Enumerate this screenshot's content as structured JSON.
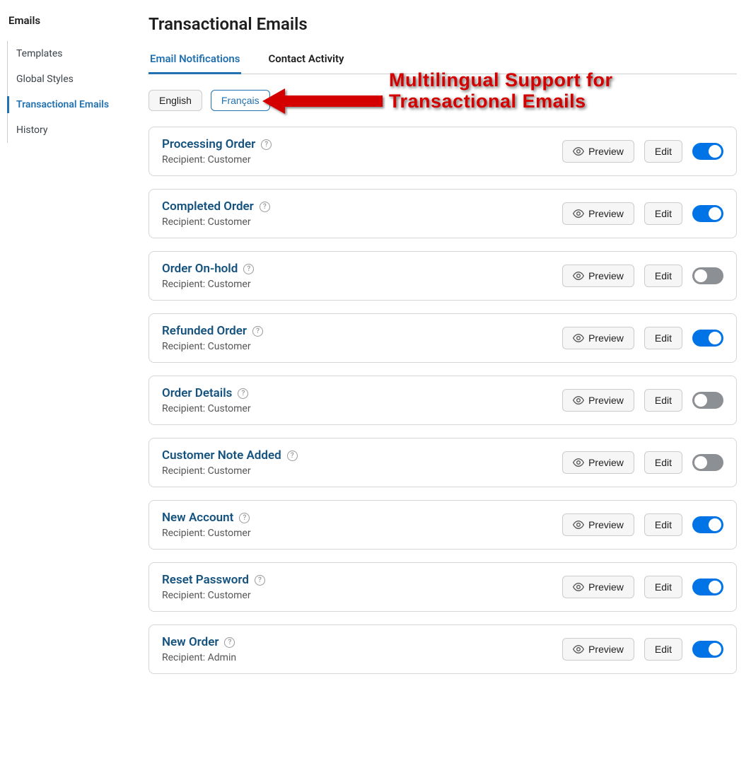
{
  "sidebar": {
    "title": "Emails",
    "items": [
      {
        "label": "Templates",
        "active": false
      },
      {
        "label": "Global Styles",
        "active": false
      },
      {
        "label": "Transactional Emails",
        "active": true
      },
      {
        "label": "History",
        "active": false
      }
    ]
  },
  "page": {
    "title": "Transactional Emails"
  },
  "tabs": [
    {
      "label": "Email Notifications",
      "active": true
    },
    {
      "label": "Contact Activity",
      "active": false
    }
  ],
  "languages": [
    {
      "label": "English",
      "active": false
    },
    {
      "label": "Français",
      "active": true
    }
  ],
  "actions": {
    "preview": "Preview",
    "edit": "Edit"
  },
  "recipient_prefix": "Recipient: ",
  "emails": [
    {
      "title": "Processing Order",
      "recipient": "Customer",
      "enabled": true
    },
    {
      "title": "Completed Order",
      "recipient": "Customer",
      "enabled": true
    },
    {
      "title": "Order On-hold",
      "recipient": "Customer",
      "enabled": false
    },
    {
      "title": "Refunded Order",
      "recipient": "Customer",
      "enabled": true
    },
    {
      "title": "Order Details",
      "recipient": "Customer",
      "enabled": false
    },
    {
      "title": "Customer Note Added",
      "recipient": "Customer",
      "enabled": false
    },
    {
      "title": "New Account",
      "recipient": "Customer",
      "enabled": true
    },
    {
      "title": "Reset Password",
      "recipient": "Customer",
      "enabled": true
    },
    {
      "title": "New Order",
      "recipient": "Admin",
      "enabled": true
    }
  ],
  "annotation": {
    "line1": "Multilingual Support for",
    "line2": "Transactional Emails"
  }
}
